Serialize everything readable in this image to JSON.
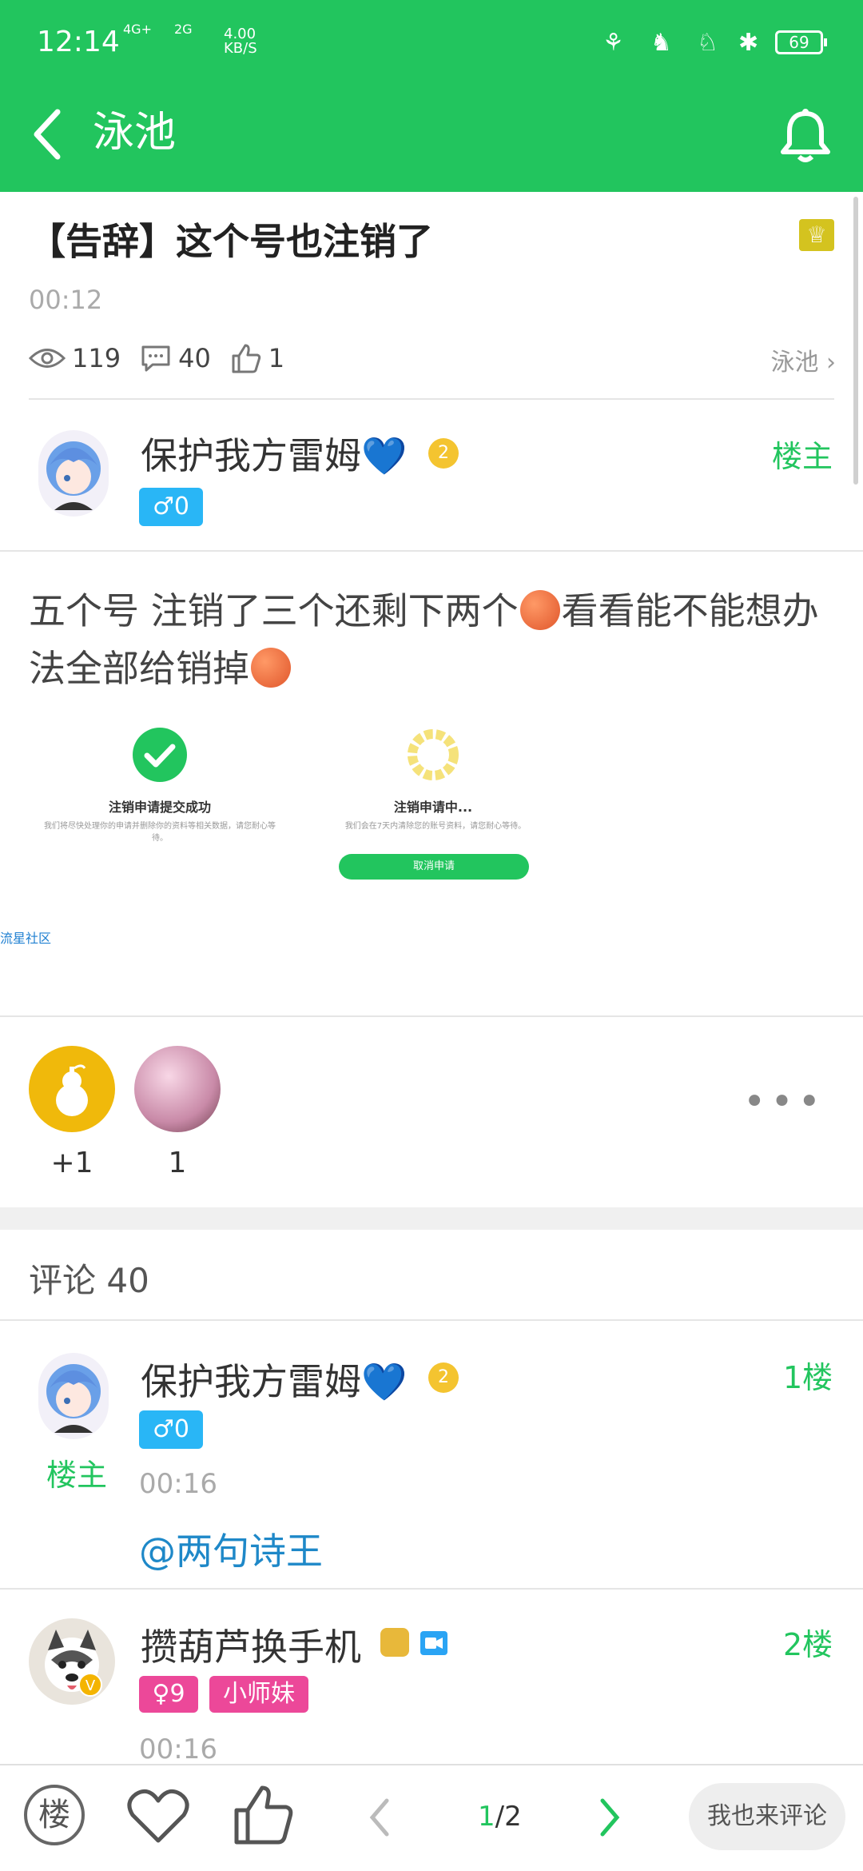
{
  "status_bar": {
    "time": "12:14",
    "net1": "4G+",
    "net2": "2G",
    "speed": "4.00",
    "speed_unit": "KB/S",
    "battery": "69"
  },
  "nav": {
    "title": "泳池"
  },
  "post": {
    "title": "【告辞】这个号也注销了",
    "time": "00:12",
    "views": "119",
    "comments": "40",
    "likes": "1",
    "forum": "泳池",
    "author": {
      "name": "保护我方雷姆💙",
      "gender": "♂0",
      "role": "楼主",
      "level_badge": "2"
    },
    "content_part1": "五个号 注销了三个还剩下两个",
    "content_part2": "看看能不能想办法全部给销掉",
    "screenshot": {
      "left_title": "注销申请提交成功",
      "left_desc": "我们将尽快处理你的申请并删除你的资料等相关数据，请您耐心等待。",
      "right_title": "注销申请中...",
      "right_desc": "我们会在7天内清除您的账号资料，请您耐心等待。",
      "right_button": "取消申请"
    },
    "watermark": "流星社区"
  },
  "reactions": [
    {
      "count": "+1"
    },
    {
      "count": "1"
    }
  ],
  "comments_header": "评论 40",
  "comments": [
    {
      "name": "保护我方雷姆💙",
      "gender": "♂0",
      "role": "楼主",
      "floor": "1楼",
      "time": "00:16",
      "text": "@两句诗王"
    },
    {
      "name": "攒葫芦换手机",
      "gender": "♀9",
      "level": "小师妹",
      "floor": "2楼",
      "time": "00:16"
    }
  ],
  "bottom_bar": {
    "floor_btn": "楼",
    "page_current": "1",
    "page_total": "/2",
    "comment_btn": "我也来评论"
  },
  "colors": {
    "accent": "#22c55e",
    "male": "#29b6f6",
    "female": "#ec4899"
  }
}
